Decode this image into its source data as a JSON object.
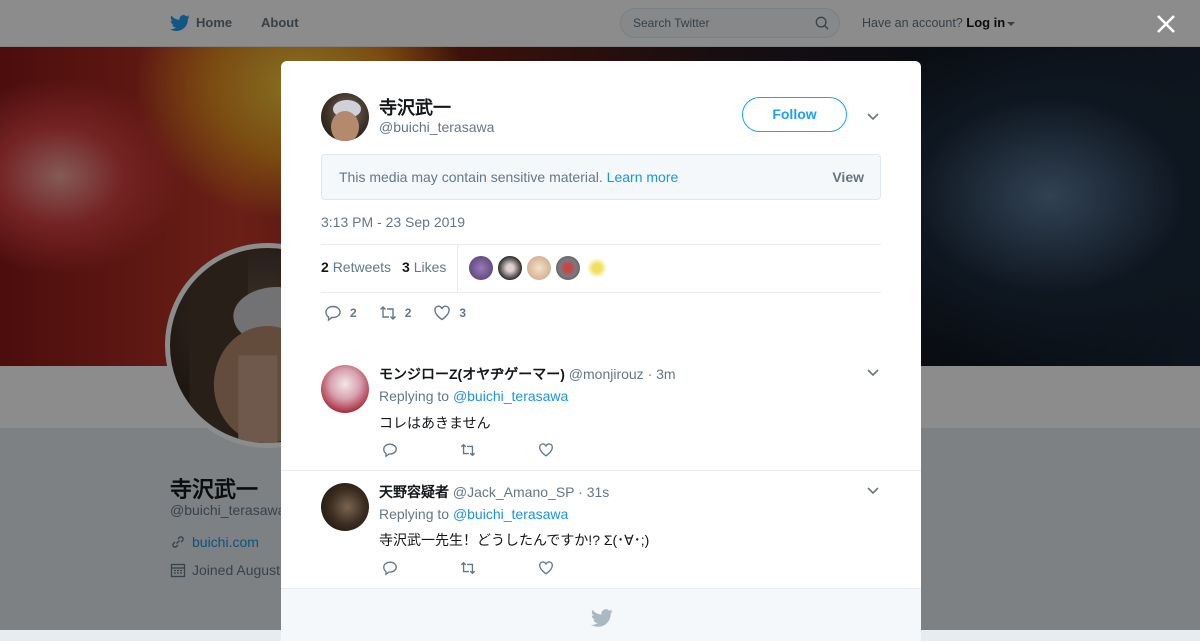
{
  "nav": {
    "home": "Home",
    "about": "About",
    "search_placeholder": "Search Twitter",
    "have_account": "Have an account?",
    "login": "Log in"
  },
  "profile": {
    "name": "寺沢武一",
    "handle": "@buichi_terasawa",
    "website": "buichi.com",
    "joined": "Joined August"
  },
  "tweet": {
    "author_name": "寺沢武一",
    "author_handle": "@buichi_terasawa",
    "follow_label": "Follow",
    "sensitive_text": "This media may contain sensitive material.",
    "learn_more": "Learn more",
    "view_label": "View",
    "timestamp": "3:13 PM - 23 Sep 2019",
    "retweets_count": "2",
    "retweets_label": "Retweets",
    "likes_count": "3",
    "likes_label": "Likes",
    "reply_count": "2",
    "retweet_action_count": "2",
    "like_action_count": "3"
  },
  "replies": [
    {
      "name": "モンジローZ(オヤヂゲーマー)",
      "handle": "@monjirouz",
      "time": "· 3m",
      "replying_prefix": "Replying to",
      "replying_to": "@buichi_terasawa",
      "text": "コレはあきません"
    },
    {
      "name": "天野容疑者",
      "handle": "@Jack_Amano_SP",
      "time": "· 31s",
      "replying_prefix": "Replying to",
      "replying_to": "@buichi_terasawa",
      "text": "寺沢武一先生！どうしたんですか!? Σ(･∀･;)"
    }
  ],
  "colors": {
    "twitter_blue": "#1da1f2",
    "link_blue": "#1b95e0",
    "secondary_text": "#657786"
  }
}
